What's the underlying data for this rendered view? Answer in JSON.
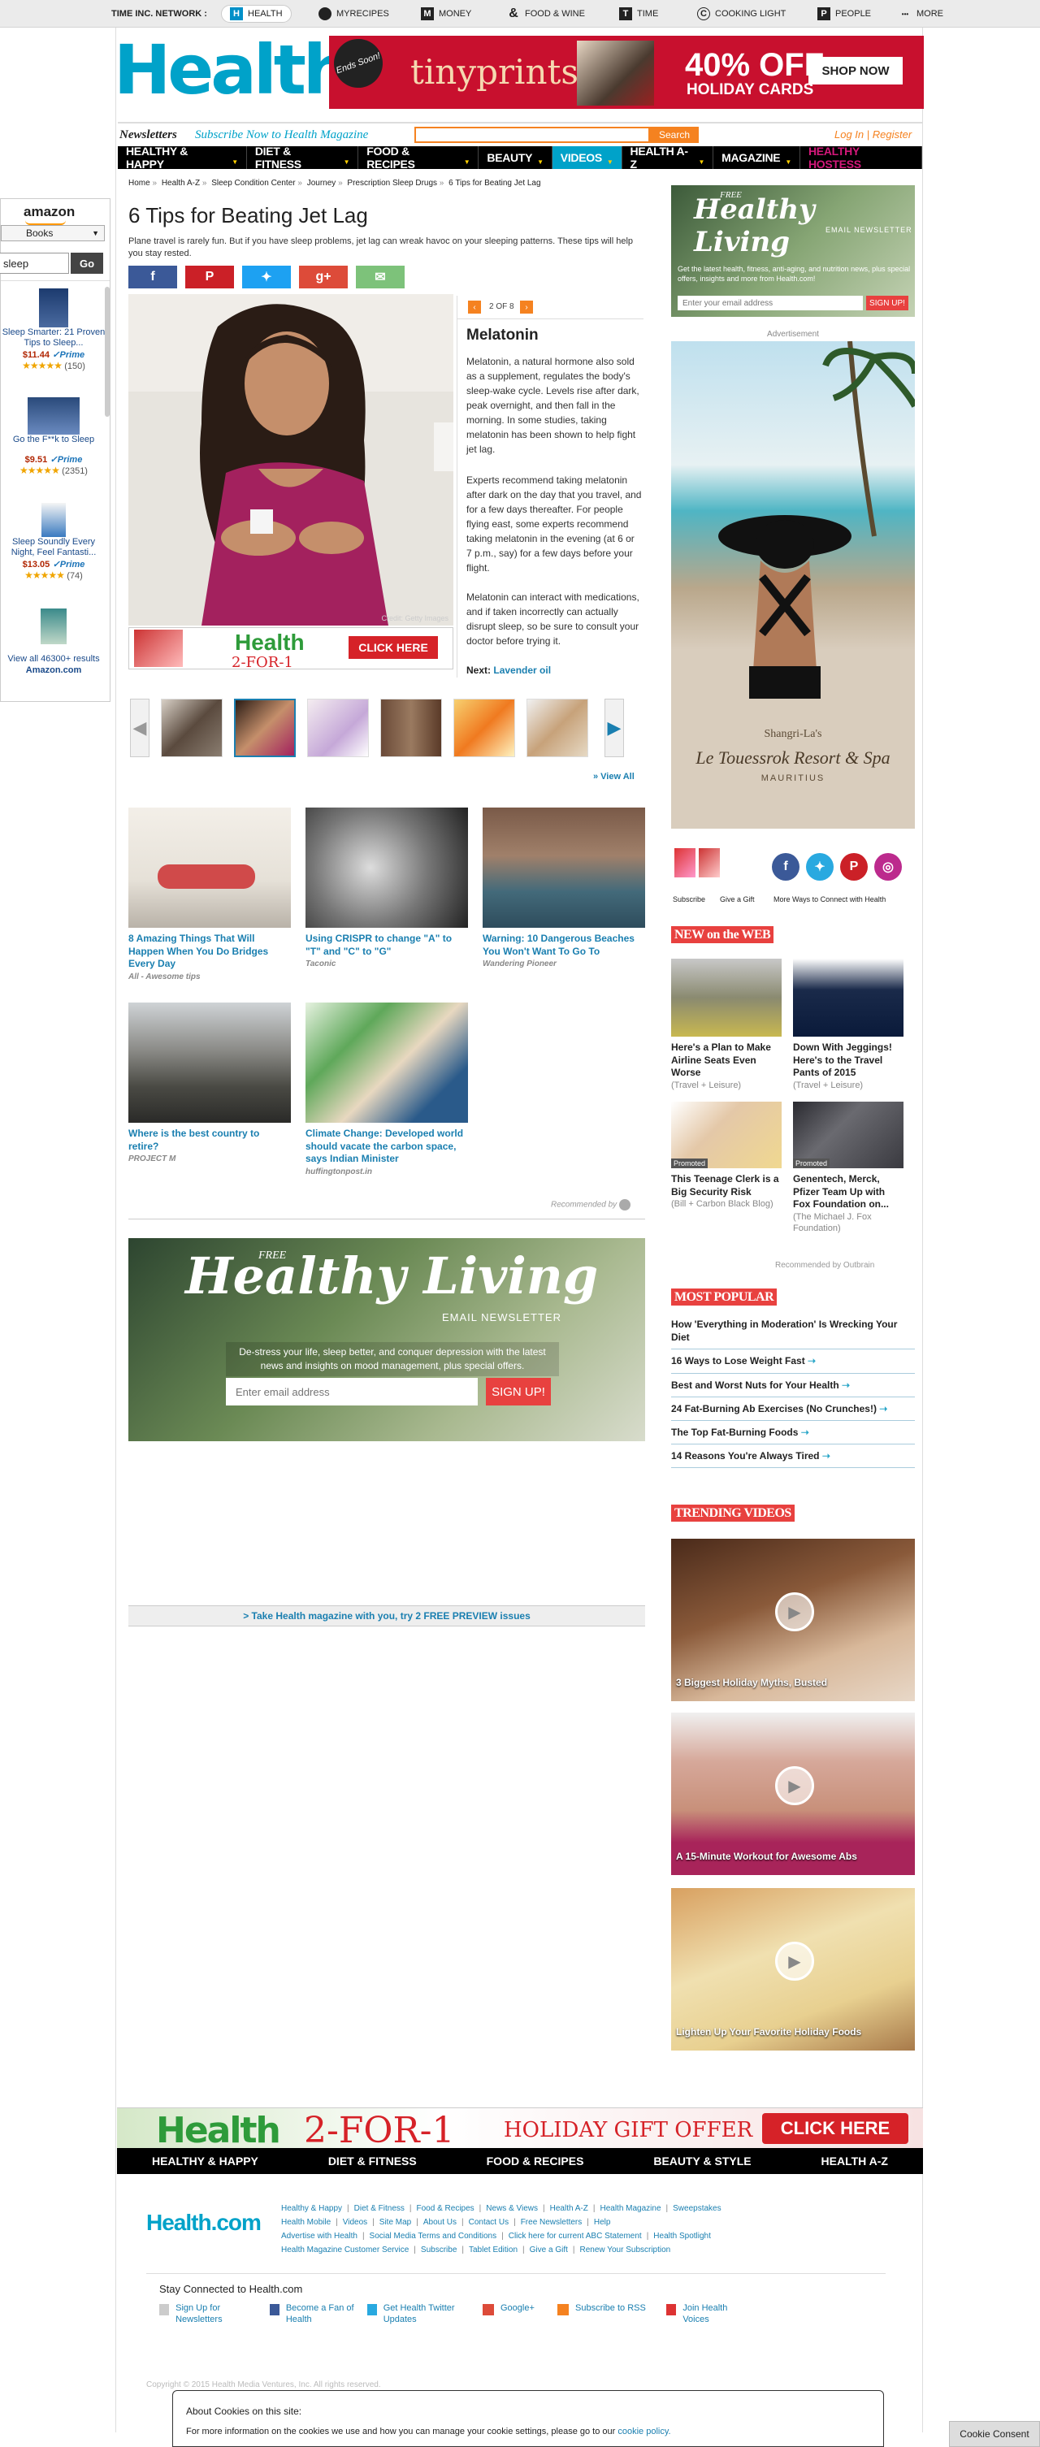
{
  "network": {
    "label": "TIME INC. NETWORK :",
    "items": [
      {
        "icon": "H",
        "label": "HEALTH"
      },
      {
        "icon": "●",
        "label": "MYRECIPES"
      },
      {
        "icon": "M",
        "label": "MONEY"
      },
      {
        "icon": "&",
        "label": "FOOD & WINE"
      },
      {
        "icon": "T",
        "label": "TIME"
      },
      {
        "icon": "C",
        "label": "COOKING LIGHT"
      },
      {
        "icon": "P",
        "label": "PEOPLE"
      },
      {
        "icon": "•••",
        "label": "MORE"
      }
    ]
  },
  "header": {
    "logo": "Health",
    "ad": {
      "ends": "Ends Soon!",
      "brand": "tinyprints",
      "offer": "40% OFF",
      "sub": "HOLIDAY CARDS",
      "cta": "SHOP NOW"
    },
    "newsletters": "Newsletters",
    "subscribe": "Subscribe Now to Health Magazine",
    "search_btn": "Search",
    "search_placeholder": "",
    "login": "Log In | Register"
  },
  "nav": [
    {
      "label": "HEALTHY & HAPPY"
    },
    {
      "label": "DIET & FITNESS"
    },
    {
      "label": "FOOD & RECIPES"
    },
    {
      "label": "BEAUTY"
    },
    {
      "label": "VIDEOS"
    },
    {
      "label": "HEALTH A-Z"
    },
    {
      "label": "MAGAZINE"
    },
    {
      "label": "HEALTHY HOSTESS"
    }
  ],
  "amazon": {
    "logo": "amazon",
    "category": "Books",
    "search_value": "sleep",
    "go": "Go",
    "products": [
      {
        "title": "Sleep Smarter: 21 Proven Tips to Sleep...",
        "price": "$11.44",
        "prime": "✓Prime",
        "reviews": "(150)"
      },
      {
        "title": "Go the F**k to Sleep",
        "price": "$9.51",
        "prime": "✓Prime",
        "reviews": "(2351)"
      },
      {
        "title": "Sleep Soundly Every Night, Feel Fantasti...",
        "price": "$13.05",
        "prime": "✓Prime",
        "reviews": "(74)"
      }
    ],
    "view_all": "View all 46300+ results",
    "view_all_2": "Amazon.com"
  },
  "breadcrumb": [
    "Home",
    "Health A-Z",
    "Sleep Condition Center",
    "Journey",
    "Prescription Sleep Drugs",
    "6 Tips for Beating Jet Lag"
  ],
  "article": {
    "title": "6 Tips for Beating Jet Lag",
    "desc": "Plane travel is rarely fun. But if you have sleep problems, jet lag can wreak havoc on your sleeping patterns. These tips will help you stay rested.",
    "credit": "Credit: Getty Images",
    "page": "2 OF 8",
    "slide_title": "Melatonin",
    "p1": "Melatonin, a natural hormone also sold as a supplement, regulates the body's sleep-wake cycle. Levels rise after dark, peak overnight, and then fall in the morning. In some studies, taking melatonin has been shown to help fight jet lag.",
    "p2": "Experts recommend taking melatonin after dark on the day that you travel, and for a few days thereafter. For people flying east, some experts recommend taking melatonin in the evening (at 6 or 7 p.m., say) for a few days before your flight.",
    "p3": "Melatonin can interact with medications, and if taken incorrectly can actually disrupt sleep, so be sure to consult your doctor before trying it.",
    "next_label": "Next:",
    "next_link": "Lavender oil",
    "view_all": "» View All",
    "small_ad": {
      "logo": "Health",
      "deal": "2-FOR-1",
      "cta": "CLICK HERE"
    }
  },
  "recommended": [
    {
      "title": "8 Amazing Things That Will Happen When You Do Bridges Every Day",
      "source": "All - Awesome tips"
    },
    {
      "title": "Using CRISPR to change \"A\" to \"T\" and \"C\" to \"G\"",
      "source": "Taconic"
    },
    {
      "title": "Warning: 10 Dangerous Beaches You Won't Want To Go To",
      "source": "Wandering Pioneer"
    },
    {
      "title": "Where is the best country to retire?",
      "source": "PROJECT M"
    },
    {
      "title": "Climate Change: Developed world should vacate the carbon space, says Indian Minister",
      "source": "huffingtonpost.in"
    }
  ],
  "recommended_by": "Recommended by",
  "healthy_living": {
    "free": "FREE",
    "title": "Healthy Living",
    "sub": "EMAIL NEWSLETTER",
    "desc": "De-stress your life, sleep better, and conquer depression with the latest news and insights on mood management, plus special offers.",
    "placeholder": "Enter email address",
    "cta": "SIGN UP!"
  },
  "healthy_living_small": {
    "desc": "Get the latest health, fitness, anti-aging, and nutrition news, plus special offers, insights and more from Health.com!",
    "placeholder": "Enter your email address",
    "cta": "SIGN UP!"
  },
  "preview": "> Take Health magazine with you, try 2 FREE PREVIEW issues",
  "advertisement": "Advertisement",
  "resort": {
    "brand": "Shangri-La's",
    "name": "Le Touessrok Resort & Spa",
    "loc": "MAURITIUS"
  },
  "social": {
    "subscribe": "Subscribe",
    "gift": "Give a Gift",
    "more": "More Ways to Connect with Health"
  },
  "new_on_web": {
    "title": "NEW on the WEB",
    "items": [
      {
        "title": "Here's a Plan to Make Airline Seats Even Worse",
        "src": "(Travel + Leisure)"
      },
      {
        "title": "Down With Jeggings! Here's to the Travel Pants of 2015",
        "src": "(Travel + Leisure)"
      },
      {
        "title": "This Teenage Clerk is a Big Security Risk",
        "src": "(Bill + Carbon Black Blog)",
        "promo": "Promoted"
      },
      {
        "title": "Genentech, Merck, Pfizer Team Up with Fox Foundation on...",
        "src": "(The Michael J. Fox Foundation)",
        "promo": "Promoted"
      }
    ],
    "recby": "Recommended by Outbrain"
  },
  "most_popular": {
    "title": "MOST POPULAR",
    "items": [
      "How 'Everything in Moderation' Is Wrecking Your Diet",
      "16 Ways to Lose Weight Fast",
      "Best and Worst Nuts for Your Health",
      "24 Fat-Burning Ab Exercises (No Crunches!)",
      "The Top Fat-Burning Foods",
      "14 Reasons You're Always Tired"
    ]
  },
  "trending": {
    "title": "TRENDING VIDEOS",
    "items": [
      "3 Biggest Holiday Myths, Busted",
      "A 15-Minute Workout for Awesome Abs",
      "Lighten Up Your Favorite Holiday Foods"
    ]
  },
  "bottom_banner": {
    "logo": "Health",
    "deal": "2-FOR-1",
    "text": "HOLIDAY GIFT OFFER",
    "cta": "CLICK HERE"
  },
  "footer_nav": [
    "HEALTHY & HAPPY",
    "DIET & FITNESS",
    "FOOD & RECIPES",
    "BEAUTY & STYLE",
    "HEALTH A-Z"
  ],
  "footer": {
    "logo": "Health.com",
    "links": [
      "Healthy & Happy",
      "Diet & Fitness",
      "Food & Recipes",
      "News & Views",
      "Health A-Z",
      "Health Magazine",
      "Sweepstakes",
      "Health Mobile",
      "Videos",
      "Site Map",
      "About Us",
      "Contact Us",
      "Free Newsletters",
      "Help",
      "Advertise with Health",
      "Social Media Terms and Conditions",
      "Click here for current ABC Statement",
      "Health Spotlight",
      "Health Magazine Customer Service",
      "Subscribe",
      "Tablet Edition",
      "Give a Gift",
      "Renew Your Subscription"
    ],
    "stay": "Stay Connected to Health.com",
    "connect": [
      {
        "label": "Sign Up for Newsletters"
      },
      {
        "label": "Become a Fan of Health"
      },
      {
        "label": "Get Health Twitter Updates"
      },
      {
        "label": "Google+"
      },
      {
        "label": "Subscribe to RSS"
      },
      {
        "label": "Join Health Voices"
      }
    ],
    "copyright": "Copyright © 2015 Health Media Ventures, Inc. All rights reserved."
  },
  "cookie": {
    "title": "About Cookies on this site:",
    "text": "For more information on the cookies we use and how you can manage your cookie settings, please go to our",
    "link": "cookie policy.",
    "consent": "Cookie Consent"
  },
  "colors": {
    "brand": "#00a2c9",
    "accent": "#f58220",
    "red": "#e8413f",
    "link": "#1a7fb0"
  }
}
